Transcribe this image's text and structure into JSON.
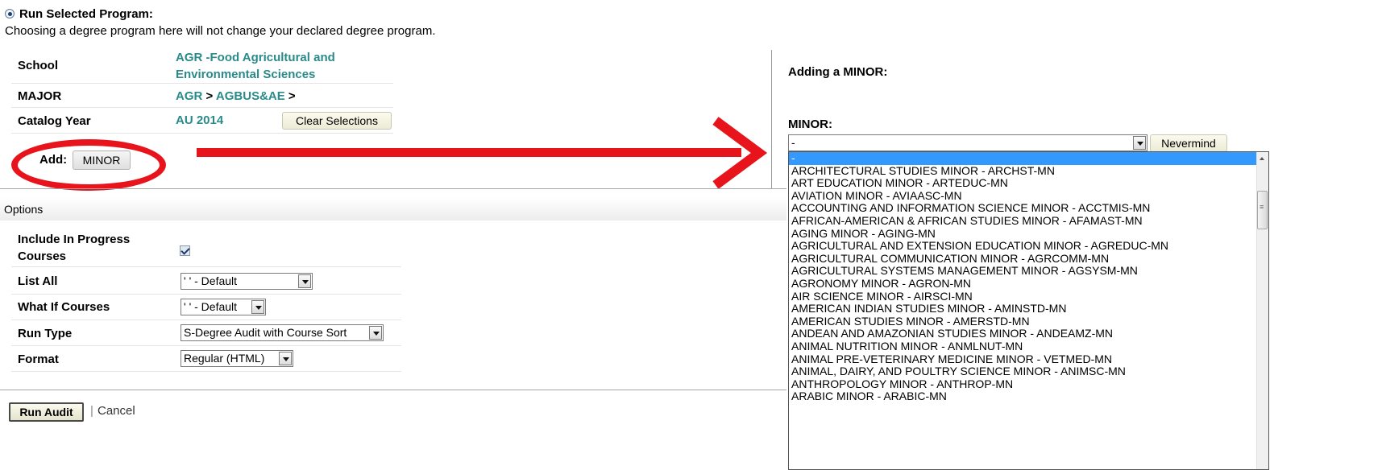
{
  "program": {
    "radio_label": "Run Selected Program:",
    "note": "Choosing a degree program here will not change your declared degree program.",
    "school_label": "School",
    "school_value_line1": "AGR -Food Agricultural and",
    "school_value_line2": "Environmental Sciences",
    "major_label": "MAJOR",
    "major_value": "AGR",
    "major_sep": ">",
    "major_sub": "AGBUS&AE",
    "major_sep2": ">",
    "catalog_label": "Catalog Year",
    "catalog_value": "AU 2014",
    "clear_button": "Clear Selections",
    "add_label": "Add:",
    "add_minor_button": "MINOR"
  },
  "options": {
    "title": "Options",
    "include_label_line1": "Include In Progress",
    "include_label_line2": "Courses",
    "include_checked": true,
    "list_all_label": "List All",
    "list_all_value": "' ' - Default",
    "what_if_label": "What If Courses",
    "what_if_value": "' ' - Default",
    "run_type_label": "Run Type",
    "run_type_value": "S-Degree Audit with Course Sort",
    "format_label": "Format",
    "format_value": "Regular (HTML)"
  },
  "footer": {
    "run_audit": "Run Audit",
    "separator": "|",
    "cancel": "Cancel"
  },
  "minor_panel": {
    "heading": "Adding a MINOR:",
    "minor_label": "MINOR:",
    "minor_value": "-",
    "nevermind": "Nevermind",
    "options": [
      "-",
      "ARCHITECTURAL STUDIES MINOR - ARCHST-MN",
      "ART EDUCATION MINOR - ARTEDUC-MN",
      "AVIATION MINOR - AVIAASC-MN",
      "ACCOUNTING AND INFORMATION SCIENCE MINOR - ACCTMIS-MN",
      "AFRICAN-AMERICAN & AFRICAN STUDIES MINOR - AFAMAST-MN",
      "AGING MINOR - AGING-MN",
      "AGRICULTURAL AND EXTENSION EDUCATION MINOR - AGREDUC-MN",
      "AGRICULTURAL COMMUNICATION MINOR - AGRCOMM-MN",
      "AGRICULTURAL SYSTEMS MANAGEMENT MINOR - AGSYSM-MN",
      "AGRONOMY MINOR - AGRON-MN",
      "AIR SCIENCE MINOR - AIRSCI-MN",
      "AMERICAN INDIAN STUDIES MINOR - AMINSTD-MN",
      "AMERICAN STUDIES MINOR - AMERSTD-MN",
      "ANDEAN AND AMAZONIAN STUDIES MINOR - ANDEAMZ-MN",
      "ANIMAL NUTRITION MINOR - ANMLNUT-MN",
      "ANIMAL PRE-VETERINARY MEDICINE MINOR - VETMED-MN",
      "ANIMAL, DAIRY, AND POULTRY SCIENCE MINOR - ANIMSC-MN",
      "ANTHROPOLOGY MINOR - ANTHROP-MN",
      "ARABIC MINOR - ARABIC-MN"
    ],
    "selected_index": 0
  },
  "colors": {
    "link_teal": "#2a8a8a",
    "annotation_red": "#e8141b",
    "selection_blue": "#3399ff"
  }
}
